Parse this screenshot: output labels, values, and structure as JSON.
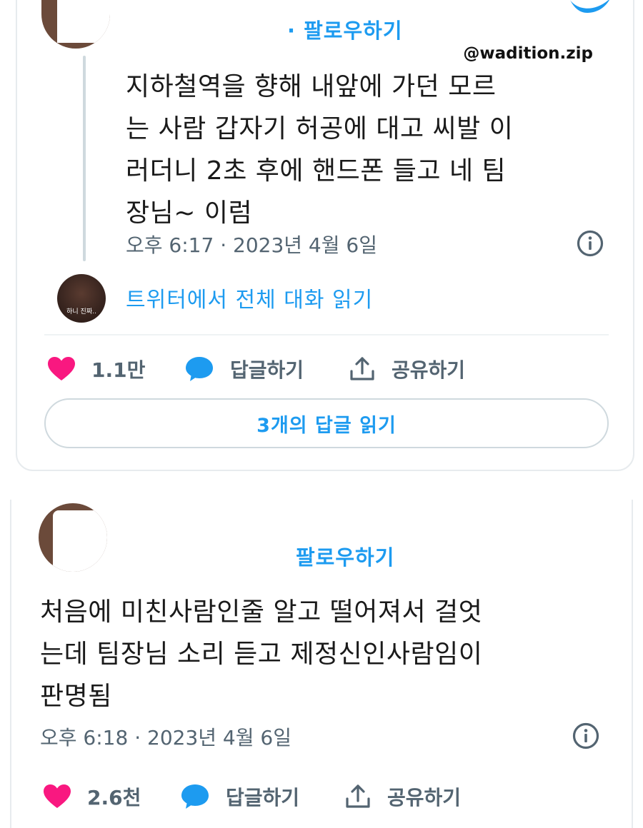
{
  "watermark": "@wadition.zip",
  "tweet1": {
    "follow_label": "· 팔로우하기",
    "text_lines": [
      "지하철역을 향해 내앞에 가던 모르",
      "는 사람 갑자기 허공에 대고 씨발 이",
      "러더니 2초 후에 핸드폰 들고 네 팀",
      "장님~ 이럼"
    ],
    "timestamp": "오후 6:17 · 2023년 4월 6일",
    "reply_avatar_caption": "하니 진짜..",
    "read_conversation": "트위터에서 전체 대화 읽기",
    "like_count": "1.1만",
    "reply_label": "답글하기",
    "share_label": "공유하기",
    "read_replies": "3개의 답글 읽기"
  },
  "tweet2": {
    "follow_label": "팔로우하기",
    "text_lines": [
      "처음에 미친사람인줄 알고 떨어져서 걸엇",
      "는데 팀장님 소리 듣고 제정신인사람임이",
      "판명됨"
    ],
    "timestamp": "오후 6:18 · 2023년 4월 6일",
    "like_count": "2.6천",
    "reply_label": "답글하기",
    "share_label": "공유하기"
  },
  "colors": {
    "accent": "#1d9bf0",
    "like": "#f91880",
    "muted": "#536471"
  },
  "icons": [
    "bird-icon",
    "info-icon",
    "heart-icon",
    "reply-bubble-icon",
    "share-icon"
  ]
}
